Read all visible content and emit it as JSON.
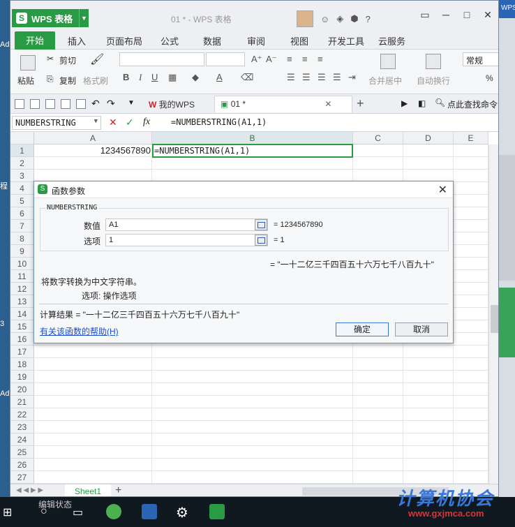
{
  "desktop": {
    "left_labels": [
      "Ad",
      "程",
      "3",
      "Ad"
    ],
    "right_label": "WPS"
  },
  "titlebar": {
    "app_name": "WPS 表格",
    "window_title": "01 * - WPS 表格",
    "icons": [
      "avatar",
      "smile-icon",
      "skin-icon",
      "settings-icon",
      "help-icon",
      "minimize-icon"
    ],
    "help_label": "?",
    "controls": [
      "▭",
      "─",
      "□",
      "✕"
    ]
  },
  "ribbon_tabs": [
    "开始",
    "插入",
    "页面布局",
    "公式",
    "数据",
    "审阅",
    "视图",
    "开发工具",
    "云服务"
  ],
  "ribbon": {
    "paste": "粘贴",
    "cut": "剪切",
    "copy": "复制",
    "format_painter": "格式刷",
    "merge_center": "合并居中",
    "wrap_text": "自动换行",
    "number_format": "常规",
    "percent": "%"
  },
  "qat": {
    "doc_tabs": [
      {
        "label": "我的WPS",
        "close": "✕"
      },
      {
        "label": "01 *",
        "close": "✕"
      }
    ],
    "add_tab": "+",
    "search": "点此查找命令"
  },
  "formula_bar": {
    "name_box": "NUMBERSTRING",
    "cancel": "✕",
    "confirm": "✓",
    "fx": "fx",
    "formula": "=NUMBERSTRING(A1,1)"
  },
  "grid": {
    "columns": [
      "A",
      "B",
      "C",
      "D",
      "E"
    ],
    "rows": [
      "1",
      "2",
      "3",
      "4",
      "5",
      "6",
      "7",
      "8",
      "9",
      "10",
      "11",
      "12",
      "13",
      "14",
      "15",
      "16",
      "17",
      "18",
      "19",
      "20",
      "21",
      "22",
      "23",
      "24",
      "25",
      "26",
      "27"
    ],
    "cell_A1": "1234567890",
    "cell_B1": "=NUMBERSTRING(A1,1)"
  },
  "dialog": {
    "title": "函数参数",
    "close": "✕",
    "function_name": "NUMBERSTRING",
    "args": [
      {
        "label": "数值",
        "value": "A1",
        "result": "= 1234567890"
      },
      {
        "label": "选项",
        "value": "1",
        "result": "= 1"
      }
    ],
    "func_result": "= \"一十二亿三千四百五十六万七千八百九十\"",
    "description": "将数字转换为中文字符串。",
    "arg_desc": "选项:  操作选项",
    "calc_result": "计算结果 = \"一十二亿三千四百五十六万七千八百九十\"",
    "help_link": "有关该函数的帮助(H)",
    "ok": "确定",
    "cancel": "取消"
  },
  "sheet_bar": {
    "sheet_name": "Sheet1",
    "add": "+",
    "status": "编辑状态"
  },
  "watermark": {
    "text": "计算机协会",
    "url": "www.gxjmca.com"
  },
  "colors": {
    "accent": "#2a9b45",
    "link": "#1a4fcf"
  }
}
